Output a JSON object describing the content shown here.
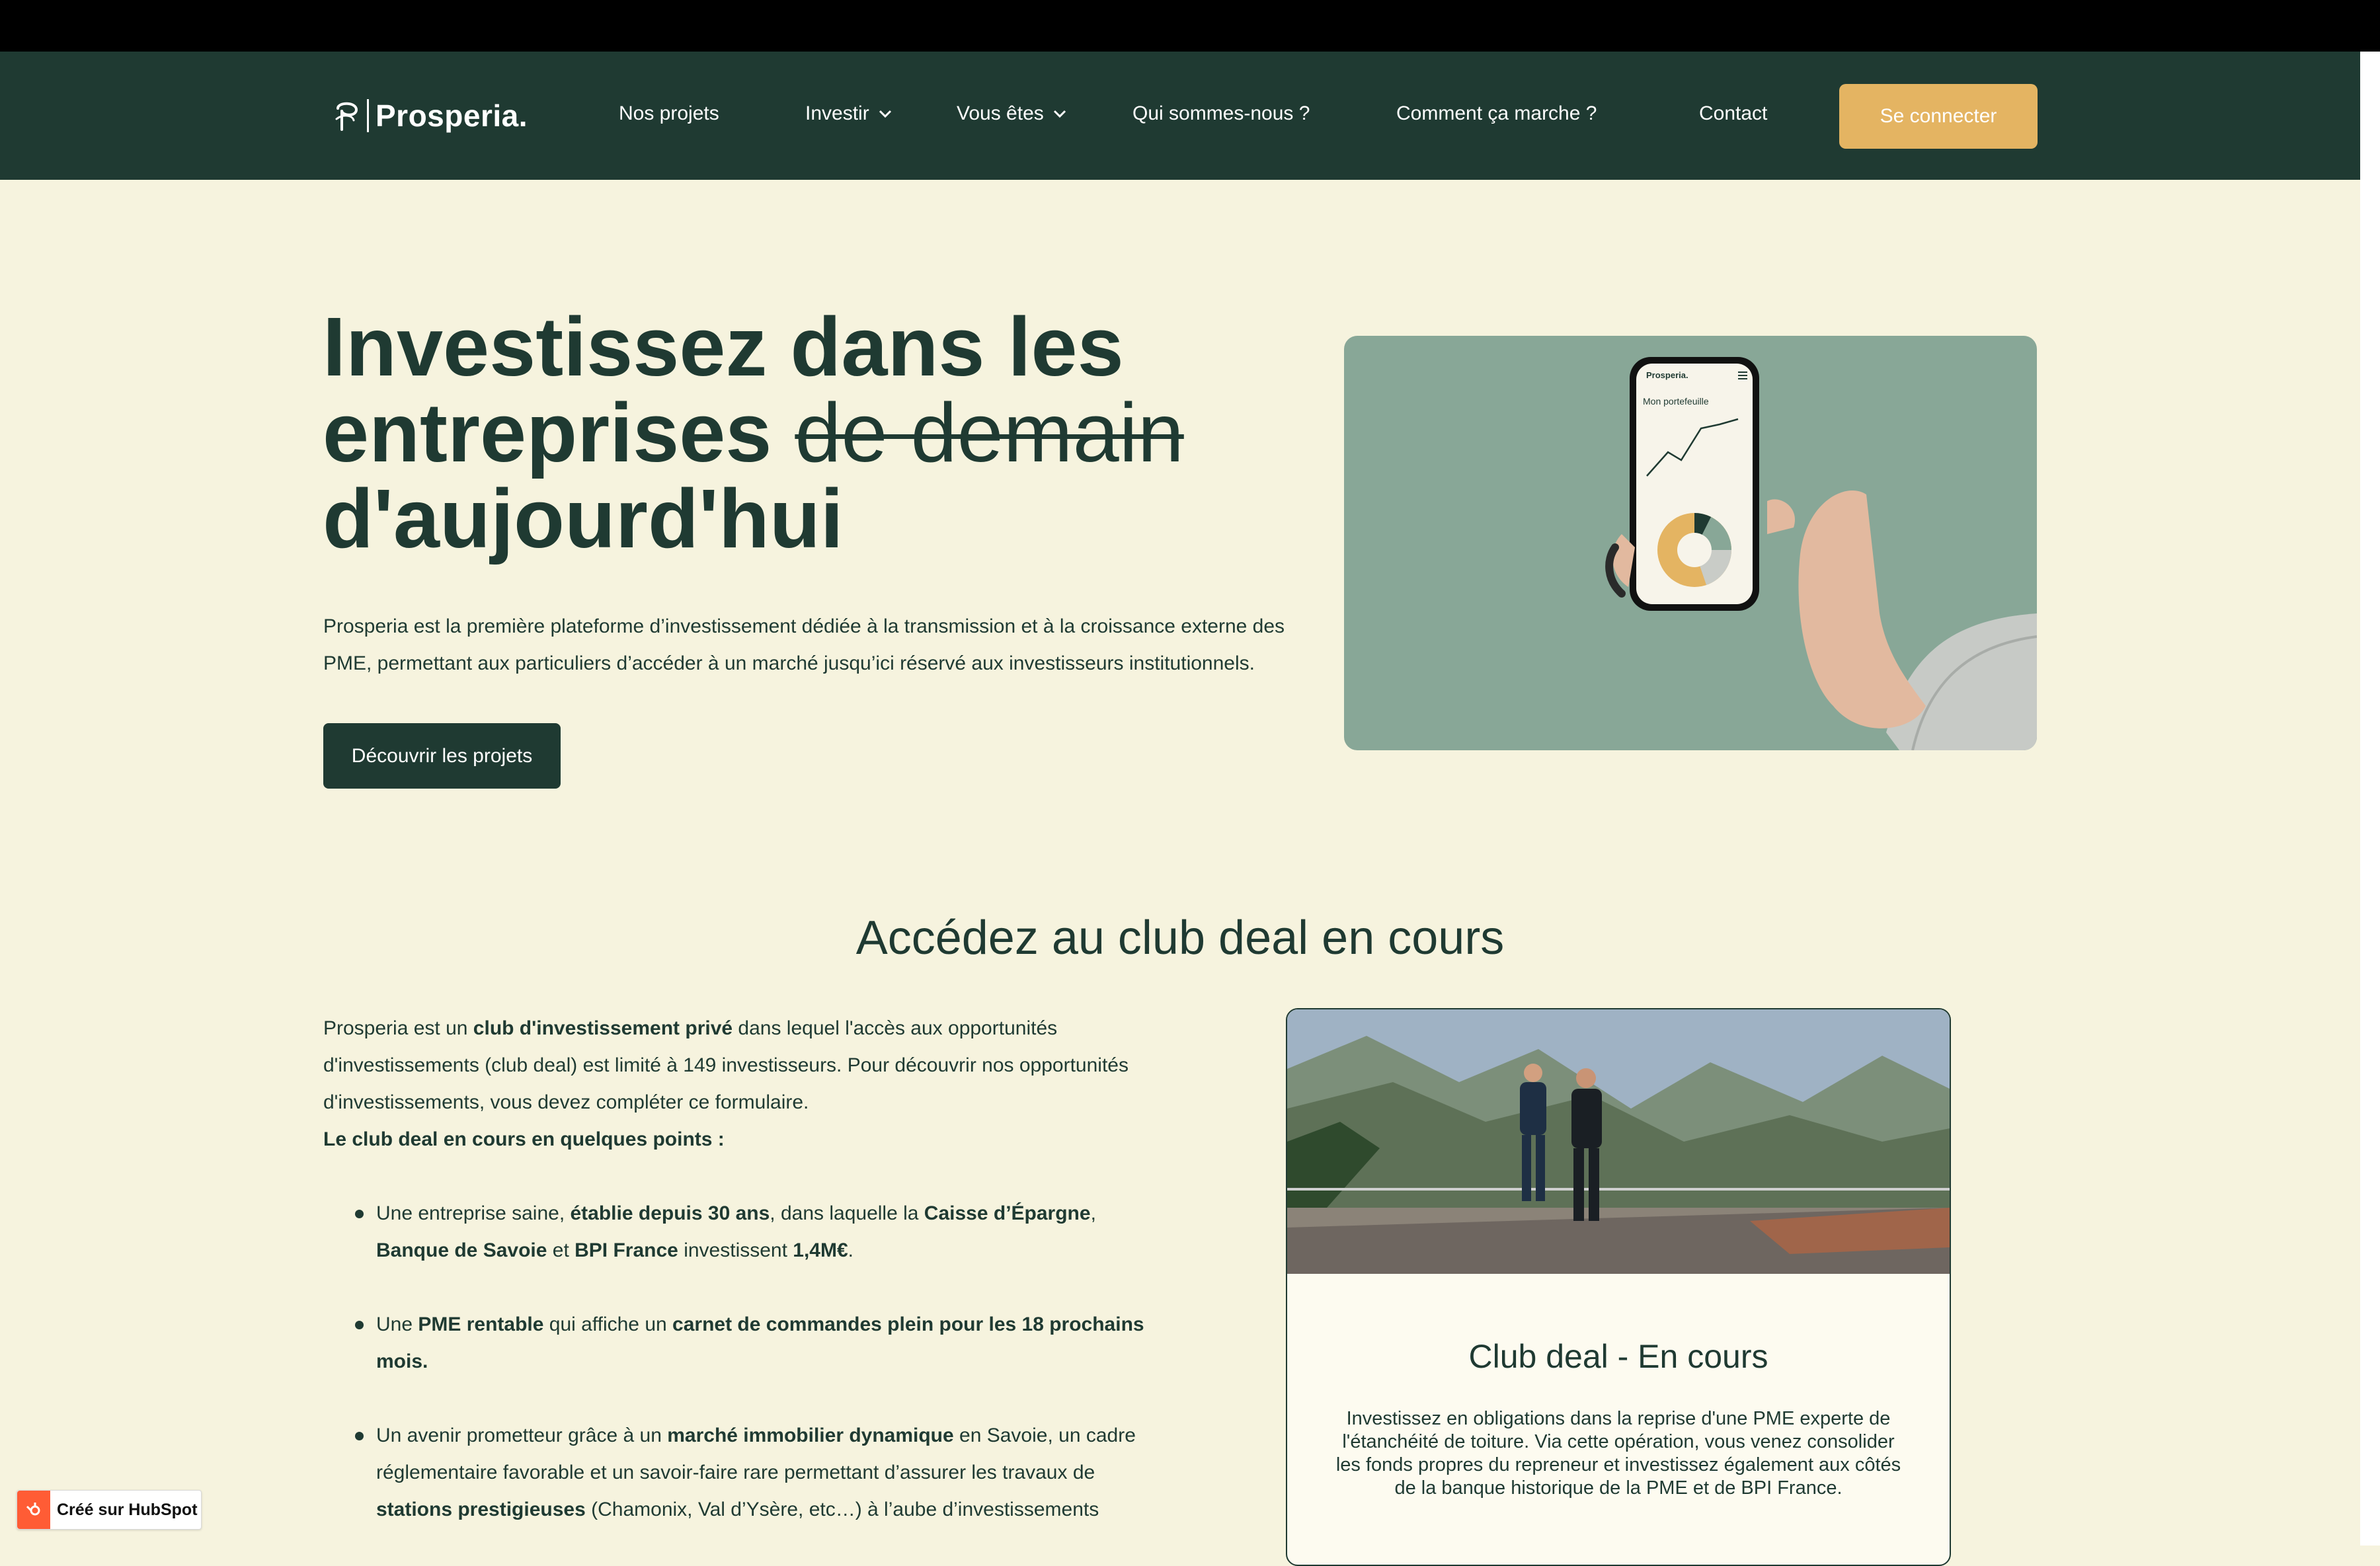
{
  "brand": {
    "name": "Prosperia.",
    "accent": "#e4b462",
    "dark": "#1f3a32",
    "background": "#f6f3de"
  },
  "nav": {
    "items": [
      {
        "label": "Nos projets"
      },
      {
        "label": "Investir"
      },
      {
        "label": "Vous êtes"
      },
      {
        "label": "Qui sommes-nous ?"
      },
      {
        "label": "Comment ça marche ?"
      },
      {
        "label": "Contact"
      }
    ],
    "login_label": "Se connecter"
  },
  "hero": {
    "title_line1": "Investissez dans les",
    "title_line2": "entreprises",
    "title_struck": "de demain",
    "title_line3": "d'aujourd'hui",
    "description": "Prosperia est la première plateforme d’investissement dédiée à la transmission et à la croissance externe des PME, permettant aux particuliers d’accéder à un marché jusqu’ici réservé aux investisseurs institutionnels.",
    "cta_label": "Découvrir les projets",
    "phone": {
      "brand": "Prosperia.",
      "screen_title": "Mon portefeuille"
    }
  },
  "club": {
    "section_title": "Accédez au club deal en cours",
    "intro_pre": "Prosperia est un ",
    "intro_bold": "club d'investissement privé",
    "intro_post": " dans lequel l'accès aux opportunités d'investissements (club deal) est limité à 149 investisseurs. Pour découvrir nos opportunités d'investissements, vous devez compléter ce formulaire.",
    "points_heading": "Le club deal en cours en quelques points :",
    "bullet1": {
      "t1": "Une entreprise saine, ",
      "b1": "établie depuis 30 ans",
      "t2": ", dans laquelle la ",
      "b2": "Caisse d’Épargne",
      "t3": ", ",
      "b3": "Banque de Savoie",
      "t4": " et ",
      "b4": "BPI France",
      "t5": " investissent ",
      "b5": "1,4M€",
      "t6": "."
    },
    "bullet2": {
      "t1": "Une ",
      "b1": "PME rentable",
      "t2": " qui affiche un ",
      "b2": "carnet de commandes plein pour les 18 prochains mois."
    },
    "bullet3": {
      "t1": "Un avenir prometteur grâce à un ",
      "b1": "marché immobilier dynamique",
      "t2": " en Savoie, un cadre réglementaire favorable et un savoir-faire rare permettant d’assurer les travaux de ",
      "b2": "stations prestigieuses",
      "t3": " (Chamonix, Val d’Ysère, etc…) à l’aube d’investissements"
    }
  },
  "deal_card": {
    "title": "Club deal - En cours",
    "description": "Investissez en obligations dans la reprise d'une PME experte de l'étanchéité de toiture. Via cette opération, vous venez consolider les fonds propres du repreneur et investissez également aux côtés de la banque historique de la PME et de BPI France."
  },
  "hubspot": {
    "label": "Créé sur HubSpot"
  }
}
